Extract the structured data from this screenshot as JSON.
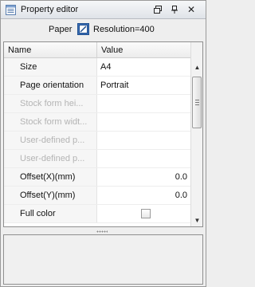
{
  "window": {
    "title": "Property editor",
    "buttons": [
      "restore-icon",
      "pin-icon",
      "close-icon"
    ],
    "close_glyph": "✕"
  },
  "info": {
    "category": "Paper",
    "resolution": "Resolution=400"
  },
  "table": {
    "headers": {
      "name": "Name",
      "value": "Value"
    },
    "rows": [
      {
        "name": "Size",
        "value": "A4",
        "disabled": false,
        "align": "left"
      },
      {
        "name": "Page orientation",
        "value": "Portrait",
        "disabled": false,
        "align": "left"
      },
      {
        "name": "Stock form hei...",
        "value": "",
        "disabled": true,
        "align": "left"
      },
      {
        "name": "Stock form widt...",
        "value": "",
        "disabled": true,
        "align": "left"
      },
      {
        "name": "User-defined p...",
        "value": "",
        "disabled": true,
        "align": "left"
      },
      {
        "name": "User-defined p...",
        "value": "",
        "disabled": true,
        "align": "left"
      },
      {
        "name": "Offset(X)(mm)",
        "value": "0.0",
        "disabled": false,
        "align": "right"
      },
      {
        "name": "Offset(Y)(mm)",
        "value": "0.0",
        "disabled": false,
        "align": "right"
      },
      {
        "name": "Full color",
        "value": "",
        "disabled": false,
        "align": "left",
        "checkbox": true,
        "checked": false
      }
    ]
  },
  "scrollbar": {
    "position": 0.12
  },
  "colors": {
    "title_bg": "#dfe3e8",
    "disabled_text": "#b4b4b4",
    "name_col_bg": "#f6f6f6"
  }
}
